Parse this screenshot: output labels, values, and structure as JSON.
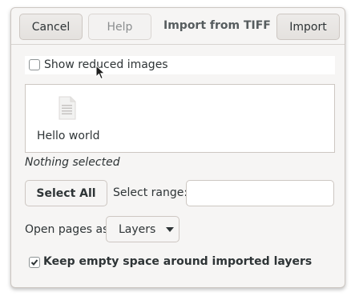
{
  "dialog": {
    "title": "Import from TIFF",
    "cancel_label": "Cancel",
    "help_label": "Help",
    "import_label": "Import"
  },
  "reduced": {
    "label": "Show reduced images",
    "checked": false
  },
  "pages": [
    {
      "name": "Hello world",
      "icon": "document-icon"
    }
  ],
  "selection_status": "Nothing selected",
  "select_all_label": "Select All",
  "select_range": {
    "label": "Select range:",
    "value": ""
  },
  "open_as": {
    "label": "Open pages as",
    "value": "Layers"
  },
  "keep_space": {
    "label": "Keep empty space around imported layers",
    "checked": true
  }
}
